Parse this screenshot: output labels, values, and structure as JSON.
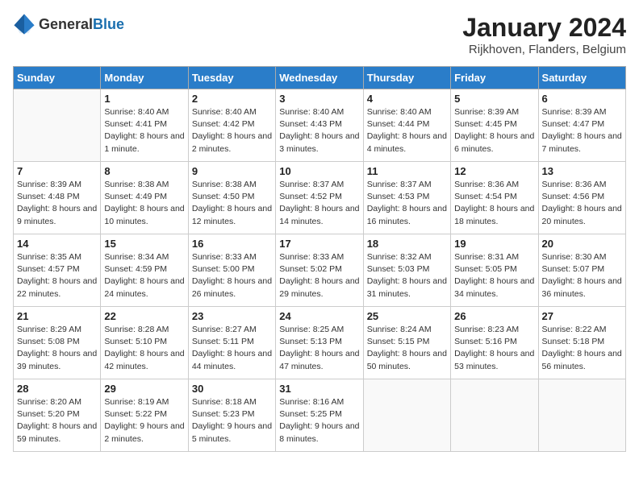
{
  "header": {
    "logo_general": "General",
    "logo_blue": "Blue",
    "month_title": "January 2024",
    "location": "Rijkhoven, Flanders, Belgium"
  },
  "days_of_week": [
    "Sunday",
    "Monday",
    "Tuesday",
    "Wednesday",
    "Thursday",
    "Friday",
    "Saturday"
  ],
  "weeks": [
    [
      {
        "day": "",
        "content": ""
      },
      {
        "day": "1",
        "content": "Sunrise: 8:40 AM\nSunset: 4:41 PM\nDaylight: 8 hours\nand 1 minute."
      },
      {
        "day": "2",
        "content": "Sunrise: 8:40 AM\nSunset: 4:42 PM\nDaylight: 8 hours\nand 2 minutes."
      },
      {
        "day": "3",
        "content": "Sunrise: 8:40 AM\nSunset: 4:43 PM\nDaylight: 8 hours\nand 3 minutes."
      },
      {
        "day": "4",
        "content": "Sunrise: 8:40 AM\nSunset: 4:44 PM\nDaylight: 8 hours\nand 4 minutes."
      },
      {
        "day": "5",
        "content": "Sunrise: 8:39 AM\nSunset: 4:45 PM\nDaylight: 8 hours\nand 6 minutes."
      },
      {
        "day": "6",
        "content": "Sunrise: 8:39 AM\nSunset: 4:47 PM\nDaylight: 8 hours\nand 7 minutes."
      }
    ],
    [
      {
        "day": "7",
        "content": "Sunrise: 8:39 AM\nSunset: 4:48 PM\nDaylight: 8 hours\nand 9 minutes."
      },
      {
        "day": "8",
        "content": "Sunrise: 8:38 AM\nSunset: 4:49 PM\nDaylight: 8 hours\nand 10 minutes."
      },
      {
        "day": "9",
        "content": "Sunrise: 8:38 AM\nSunset: 4:50 PM\nDaylight: 8 hours\nand 12 minutes."
      },
      {
        "day": "10",
        "content": "Sunrise: 8:37 AM\nSunset: 4:52 PM\nDaylight: 8 hours\nand 14 minutes."
      },
      {
        "day": "11",
        "content": "Sunrise: 8:37 AM\nSunset: 4:53 PM\nDaylight: 8 hours\nand 16 minutes."
      },
      {
        "day": "12",
        "content": "Sunrise: 8:36 AM\nSunset: 4:54 PM\nDaylight: 8 hours\nand 18 minutes."
      },
      {
        "day": "13",
        "content": "Sunrise: 8:36 AM\nSunset: 4:56 PM\nDaylight: 8 hours\nand 20 minutes."
      }
    ],
    [
      {
        "day": "14",
        "content": "Sunrise: 8:35 AM\nSunset: 4:57 PM\nDaylight: 8 hours\nand 22 minutes."
      },
      {
        "day": "15",
        "content": "Sunrise: 8:34 AM\nSunset: 4:59 PM\nDaylight: 8 hours\nand 24 minutes."
      },
      {
        "day": "16",
        "content": "Sunrise: 8:33 AM\nSunset: 5:00 PM\nDaylight: 8 hours\nand 26 minutes."
      },
      {
        "day": "17",
        "content": "Sunrise: 8:33 AM\nSunset: 5:02 PM\nDaylight: 8 hours\nand 29 minutes."
      },
      {
        "day": "18",
        "content": "Sunrise: 8:32 AM\nSunset: 5:03 PM\nDaylight: 8 hours\nand 31 minutes."
      },
      {
        "day": "19",
        "content": "Sunrise: 8:31 AM\nSunset: 5:05 PM\nDaylight: 8 hours\nand 34 minutes."
      },
      {
        "day": "20",
        "content": "Sunrise: 8:30 AM\nSunset: 5:07 PM\nDaylight: 8 hours\nand 36 minutes."
      }
    ],
    [
      {
        "day": "21",
        "content": "Sunrise: 8:29 AM\nSunset: 5:08 PM\nDaylight: 8 hours\nand 39 minutes."
      },
      {
        "day": "22",
        "content": "Sunrise: 8:28 AM\nSunset: 5:10 PM\nDaylight: 8 hours\nand 42 minutes."
      },
      {
        "day": "23",
        "content": "Sunrise: 8:27 AM\nSunset: 5:11 PM\nDaylight: 8 hours\nand 44 minutes."
      },
      {
        "day": "24",
        "content": "Sunrise: 8:25 AM\nSunset: 5:13 PM\nDaylight: 8 hours\nand 47 minutes."
      },
      {
        "day": "25",
        "content": "Sunrise: 8:24 AM\nSunset: 5:15 PM\nDaylight: 8 hours\nand 50 minutes."
      },
      {
        "day": "26",
        "content": "Sunrise: 8:23 AM\nSunset: 5:16 PM\nDaylight: 8 hours\nand 53 minutes."
      },
      {
        "day": "27",
        "content": "Sunrise: 8:22 AM\nSunset: 5:18 PM\nDaylight: 8 hours\nand 56 minutes."
      }
    ],
    [
      {
        "day": "28",
        "content": "Sunrise: 8:20 AM\nSunset: 5:20 PM\nDaylight: 8 hours\nand 59 minutes."
      },
      {
        "day": "29",
        "content": "Sunrise: 8:19 AM\nSunset: 5:22 PM\nDaylight: 9 hours\nand 2 minutes."
      },
      {
        "day": "30",
        "content": "Sunrise: 8:18 AM\nSunset: 5:23 PM\nDaylight: 9 hours\nand 5 minutes."
      },
      {
        "day": "31",
        "content": "Sunrise: 8:16 AM\nSunset: 5:25 PM\nDaylight: 9 hours\nand 8 minutes."
      },
      {
        "day": "",
        "content": ""
      },
      {
        "day": "",
        "content": ""
      },
      {
        "day": "",
        "content": ""
      }
    ]
  ]
}
